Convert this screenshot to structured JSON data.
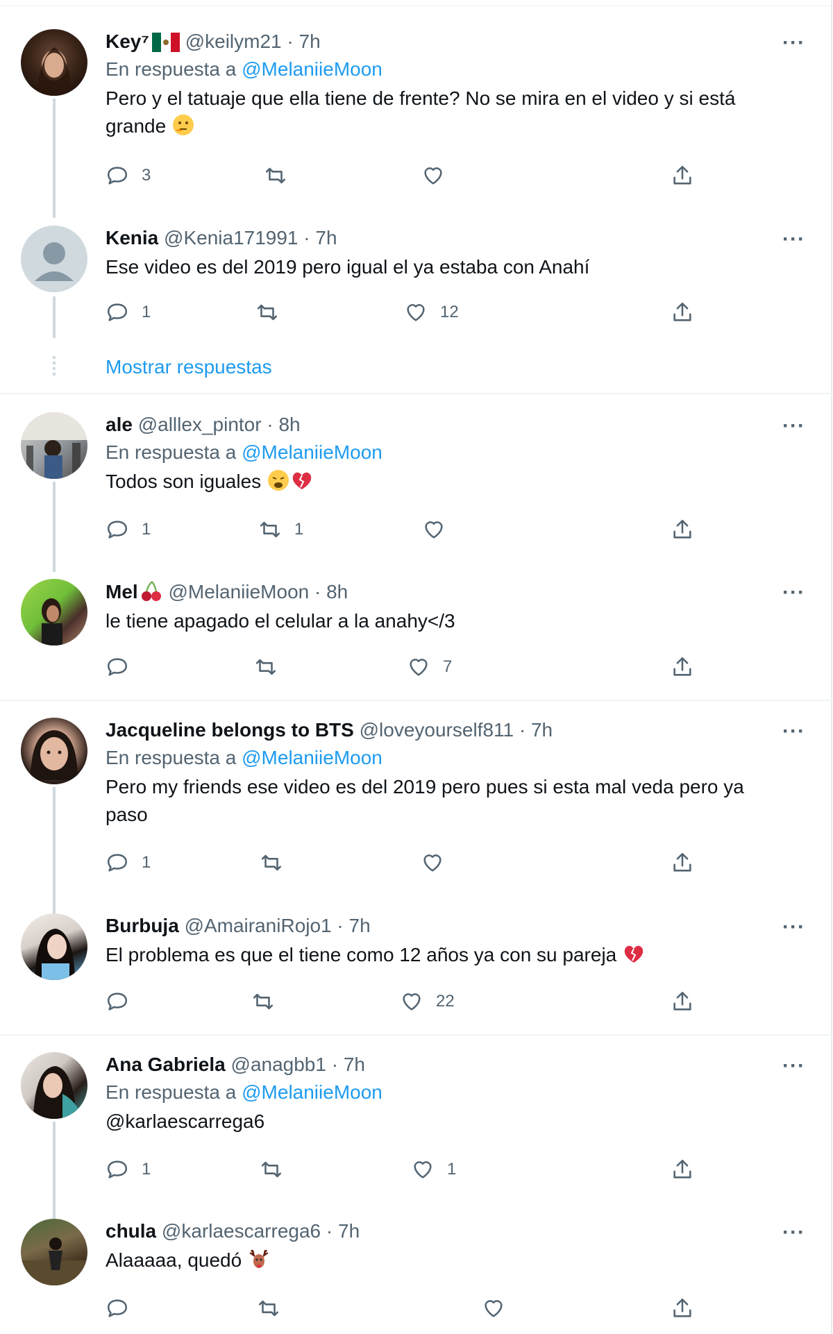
{
  "tweets": [
    {
      "name": "Key⁷",
      "handle": "@keilym21",
      "time": "· 7h",
      "reply_label": "En respuesta a",
      "reply_to": "@MelaniieMoon",
      "text": "Pero y el tatuaje que ella tiene de frente? No se mira en el video y si está",
      "text2": "grande",
      "replies": "3",
      "retweets": "",
      "likes": ""
    },
    {
      "name": "Kenia",
      "handle": "@Kenia171991",
      "time": "· 7h",
      "text": "Ese video es del 2019 pero igual el ya estaba con Anahí",
      "replies": "1",
      "retweets": "",
      "likes": "12",
      "show_replies": "Mostrar respuestas"
    },
    {
      "name": "ale",
      "handle": "@alllex_pintor",
      "time": "· 8h",
      "reply_label": "En respuesta a",
      "reply_to": "@MelaniieMoon",
      "text": "Todos son iguales",
      "replies": "1",
      "retweets": "1",
      "likes": ""
    },
    {
      "name": "Mel",
      "handle": "@MelaniieMoon",
      "time": "· 8h",
      "text": "le tiene apagado el celular a la anahy</3",
      "replies": "",
      "retweets": "",
      "likes": "7"
    },
    {
      "name": "Jacqueline belongs to BTS",
      "handle": "@loveyourself811",
      "time": "· 7h",
      "reply_label": "En respuesta a",
      "reply_to": "@MelaniieMoon",
      "text": "Pero my friends ese video es del 2019 pero pues si esta mal veda pero ya",
      "text2": "paso",
      "replies": "1",
      "retweets": "",
      "likes": ""
    },
    {
      "name": "Burbuja",
      "handle": "@AmairaniRojo1",
      "time": "· 7h",
      "text": "El problema es que el tiene como 12 años ya con su pareja",
      "replies": "",
      "retweets": "",
      "likes": "22"
    },
    {
      "name": "Ana Gabriela",
      "handle": "@anagbb1",
      "time": "· 7h",
      "reply_label": "En respuesta a",
      "reply_to": "@MelaniieMoon",
      "mention_line": "@karlaescarrega6",
      "replies": "1",
      "retweets": "",
      "likes": "1"
    },
    {
      "name": "chula",
      "handle": "@karlaescarrega6",
      "time": "· 7h",
      "text": "Alaaaaa, quedó",
      "replies": "",
      "retweets": "",
      "likes": ""
    }
  ],
  "more_icon": "···",
  "icons": {
    "reply": "reply-icon",
    "retweet": "retweet-icon",
    "like": "heart-icon",
    "share": "share-icon"
  },
  "colors": {
    "link": "#1d9bf0",
    "secondary": "#536471",
    "border": "#eff3f4"
  }
}
